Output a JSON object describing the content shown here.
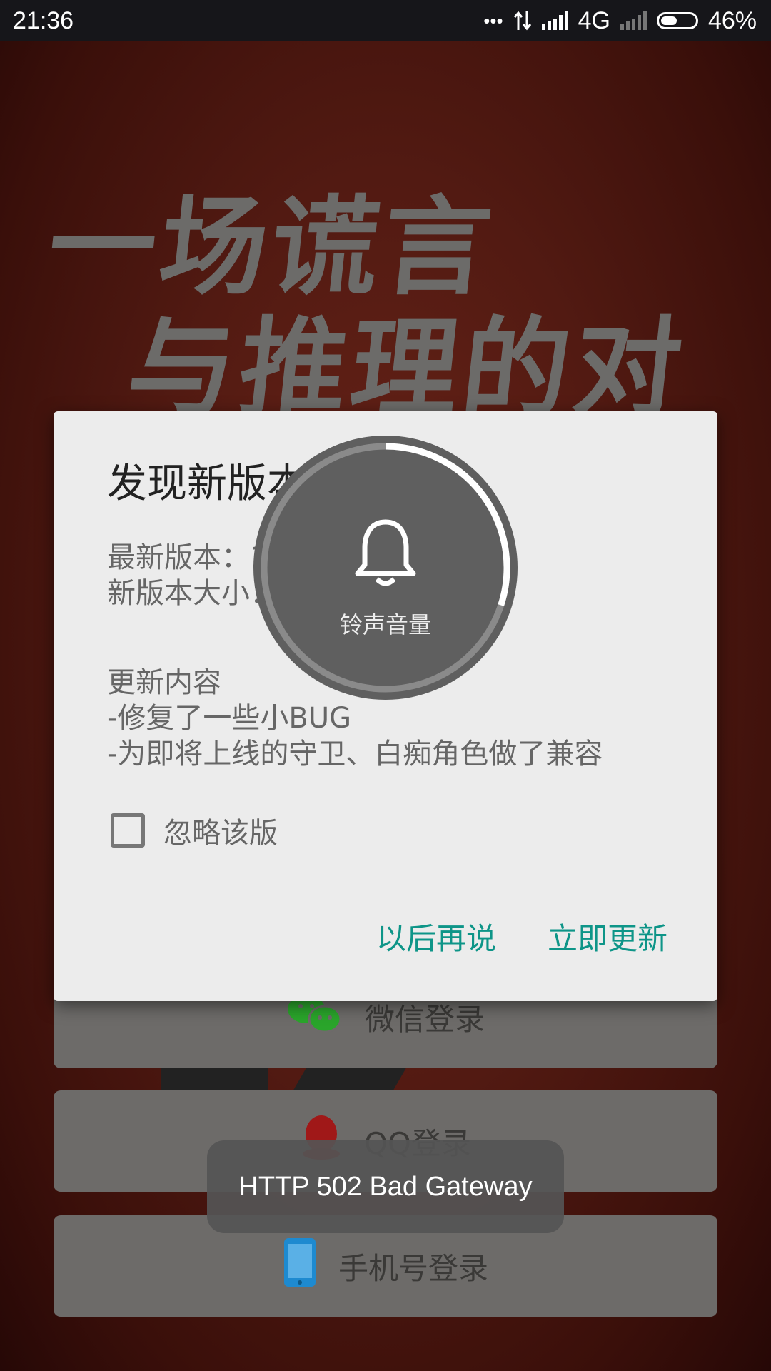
{
  "status_bar": {
    "time": "21:36",
    "dots": "•••",
    "network": "4G",
    "battery": "46%"
  },
  "background": {
    "line1": "一场谎言",
    "line2": "与推理的对抗"
  },
  "login": {
    "wechat": "微信登录",
    "qq": "QQ登录",
    "phone": "手机号登录"
  },
  "dialog": {
    "title": "发现新版本",
    "version_label": "最新版本：1.4.8",
    "size_label": "新版本大小：31.9M",
    "content_head": "更新内容",
    "content_1": "-修复了一些小BUG",
    "content_2": "-为即将上线的守卫、白痴角色做了兼容",
    "ignore_label": "忽略该版",
    "later_button": "以后再说",
    "update_button": "立即更新"
  },
  "volume": {
    "label": "铃声音量",
    "level_fraction": 0.3
  },
  "toast": {
    "text": "HTTP 502 Bad Gateway"
  },
  "colors": {
    "accent": "#0e9588",
    "wechat": "#2aa52b",
    "qq": "#c0201d",
    "phone": "#1e8ad0"
  }
}
